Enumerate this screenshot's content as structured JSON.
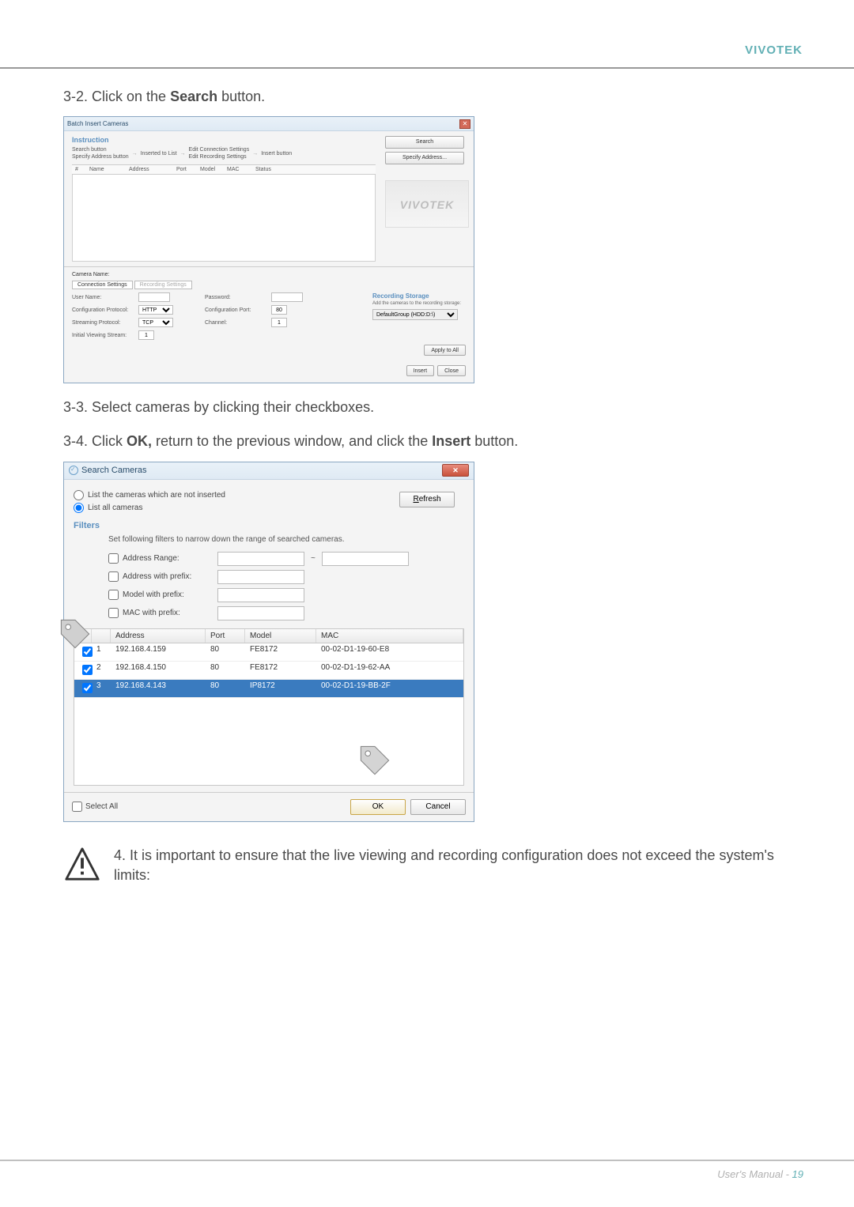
{
  "brand": "VIVOTEK",
  "steps": {
    "s32_pre": "3-2. Click on the ",
    "s32_bold": "Search",
    "s32_post": " button.",
    "s33": "3-3. Select cameras by clicking their checkboxes.",
    "s34_pre": "3-4. Click ",
    "s34_b1": "OK,",
    "s34_mid": " return to the previous window, and click the ",
    "s34_b2": "Insert",
    "s34_post": " button."
  },
  "dialog1": {
    "title": "Batch Insert Cameras",
    "instruction": "Instruction",
    "col1a": "Search button",
    "col1b": "Specify Address button",
    "step2": "Inserted to List",
    "step3_title": "Edit Connection Settings",
    "step3": "Edit Recording Settings",
    "step4": "Insert button",
    "cols": {
      "chk": "#",
      "name": "Name",
      "addr": "Address",
      "port": "Port",
      "model": "Model",
      "mac": "MAC",
      "status": "Status"
    },
    "ghost": "VIVOTEK",
    "btn_search": "Search",
    "btn_specify": "Specify Address...",
    "camera_name": "Camera Name:",
    "tab_conn": "Connection Settings",
    "tab_rec": "Recording Settings",
    "f_user": "User Name:",
    "f_pass": "Password:",
    "f_conf": "Configuration Protocol:",
    "f_confport": "Configuration Port:",
    "f_conf_val": "HTTP",
    "f_confport_val": "80",
    "f_stream": "Streaming Protocol:",
    "f_stream_val": "TCP",
    "f_channel": "Channel:",
    "f_ch1": "1",
    "f_view": "Initial Viewing Stream:",
    "f_v1": "1",
    "apply": "Apply to All",
    "rs_title": "Recording Storage",
    "rs_sub": "Add the cameras to the recording storage:",
    "rs_val": "DefaultGroup (HDD:D:\\)",
    "insert": "Insert",
    "close": "Close"
  },
  "dialog2": {
    "title": "Search Cameras",
    "r1": "List the cameras which are not inserted",
    "r2": "List all cameras",
    "refresh": "Refresh",
    "filters": "Filters",
    "filters_desc": "Set following filters to narrow down the range of searched cameras.",
    "f_range": "Address Range:",
    "f_addrpre": "Address with prefix:",
    "f_modelpre": "Model with prefix:",
    "f_macpre": "MAC with prefix:",
    "cols": {
      "addr": "Address",
      "port": "Port",
      "model": "Model",
      "mac": "MAC"
    },
    "rows": [
      {
        "n": "1",
        "addr": "192.168.4.159",
        "port": "80",
        "model": "FE8172",
        "mac": "00-02-D1-19-60-E8"
      },
      {
        "n": "2",
        "addr": "192.168.4.150",
        "port": "80",
        "model": "FE8172",
        "mac": "00-02-D1-19-62-AA"
      },
      {
        "n": "3",
        "addr": "192.168.4.143",
        "port": "80",
        "model": "IP8172",
        "mac": "00-02-D1-19-BB-2F"
      }
    ],
    "select_all": "Select All",
    "ok": "OK",
    "cancel": "Cancel"
  },
  "warning": {
    "text": "4. It is important to ensure that the live viewing and recording configuration does not exceed the system's limits:"
  },
  "footer": {
    "label": "User's Manual - ",
    "page": "19"
  }
}
